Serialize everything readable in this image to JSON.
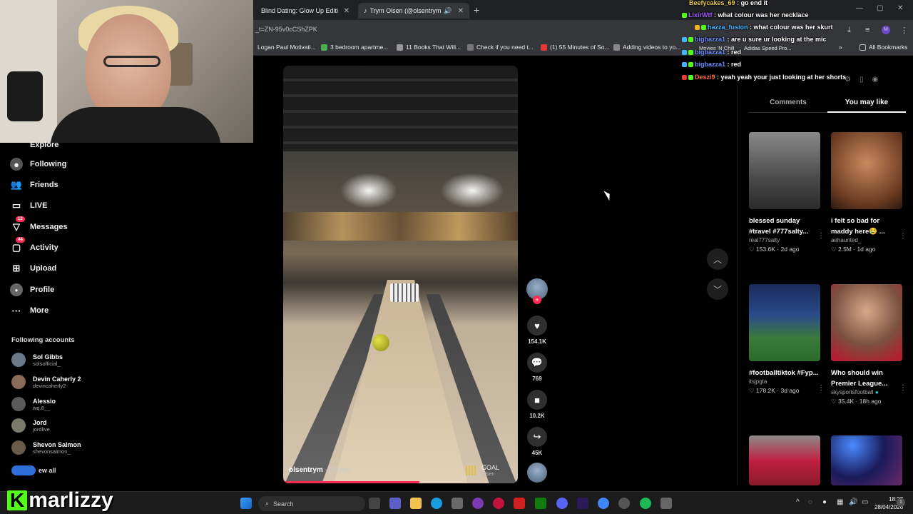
{
  "browser": {
    "tabs": [
      {
        "title": "Blind Dating: Glow Up Edition"
      },
      {
        "title": "Trym Olsen (@olsentrym)'s"
      }
    ],
    "url": "_t=ZN-95v0cCShZPK",
    "bookmarks": [
      "Logan Paul Motivati...",
      "3 bedroom apartme...",
      "11 Books That Will...",
      "Check if you need t...",
      "(1) 55 Minutes of So...",
      "Adding videos to yo...",
      "Movies 'N Chill",
      "Adidas Speed Pro...",
      "All Bookmarks"
    ]
  },
  "nav": {
    "items": [
      {
        "label": "Explore",
        "icon": "compass-icon"
      },
      {
        "label": "Following",
        "icon": "following-icon"
      },
      {
        "label": "Friends",
        "icon": "friends-icon"
      },
      {
        "label": "LIVE",
        "icon": "live-icon"
      },
      {
        "label": "Messages",
        "icon": "messages-icon",
        "badge": "12"
      },
      {
        "label": "Activity",
        "icon": "activity-icon",
        "badge": "44"
      },
      {
        "label": "Upload",
        "icon": "upload-icon"
      },
      {
        "label": "Profile",
        "icon": "profile-icon"
      },
      {
        "label": "More",
        "icon": "more-icon"
      }
    ],
    "following_title": "Following accounts",
    "accounts": [
      {
        "name": "Sol Gibbs",
        "handle": "solsofficial_"
      },
      {
        "name": "Devin Caherly 2",
        "handle": "devincaherly2"
      },
      {
        "name": "Alessio",
        "handle": "wq.8__"
      },
      {
        "name": "Jord",
        "handle": "jordlive"
      },
      {
        "name": "Shevon Salmon",
        "handle": "shevonsalmon_"
      }
    ],
    "see_all": "ew all"
  },
  "video": {
    "author": "olsentrym",
    "ago": "· 6d ago",
    "music_title": "GOAL",
    "music_sub": "Olsen",
    "progress": 0.58
  },
  "actions": {
    "likes": "154.1K",
    "comments": "769",
    "saves": "10.2K",
    "shares": "45K"
  },
  "right_panel": {
    "tabs": [
      "Comments",
      "You may like"
    ],
    "cards": [
      {
        "title": "blessed sunday #travel #777salty...",
        "user": "real777salty",
        "likes": "153.6K",
        "ago": "2d ago"
      },
      {
        "title": "i felt so bad for maddy here😢 ...",
        "user": "aehaunted_",
        "likes": "2.5M",
        "ago": "1d ago"
      },
      {
        "title": "#footballtiktok #Fyp...",
        "user": "itsjpgta",
        "likes": "178.2K",
        "ago": "3d ago"
      },
      {
        "title": "Who should win Premier League...",
        "user": "skysportsfootball",
        "likes": "35.4K",
        "ago": "18h ago"
      }
    ]
  },
  "chat": [
    {
      "user": "Beefycakes_69",
      "msg": "go end it",
      "color": "#e6c84a"
    },
    {
      "user": "LixirWtf",
      "msg": "what colour was her necklace",
      "color": "#a25cff"
    },
    {
      "user": "hazza_fusion",
      "msg": "what colour was her skurt",
      "color": "#3fb8ff"
    },
    {
      "user": "bigbazza1",
      "msg": "are u sure ur looking at the mic",
      "color": "#6b8cff"
    },
    {
      "user": "bigbazza1",
      "msg": "red",
      "color": "#6b8cff"
    },
    {
      "user": "bigbazza1",
      "msg": "red",
      "color": "#6b8cff"
    },
    {
      "user": "Deszi9",
      "msg": "yeah yeah your just looking at her shorts",
      "color": "#ff6b3d"
    }
  ],
  "taskbar": {
    "search": "Search",
    "time": "18:27",
    "date": "28/04/2026"
  },
  "overlay_logo": "marlizzy"
}
